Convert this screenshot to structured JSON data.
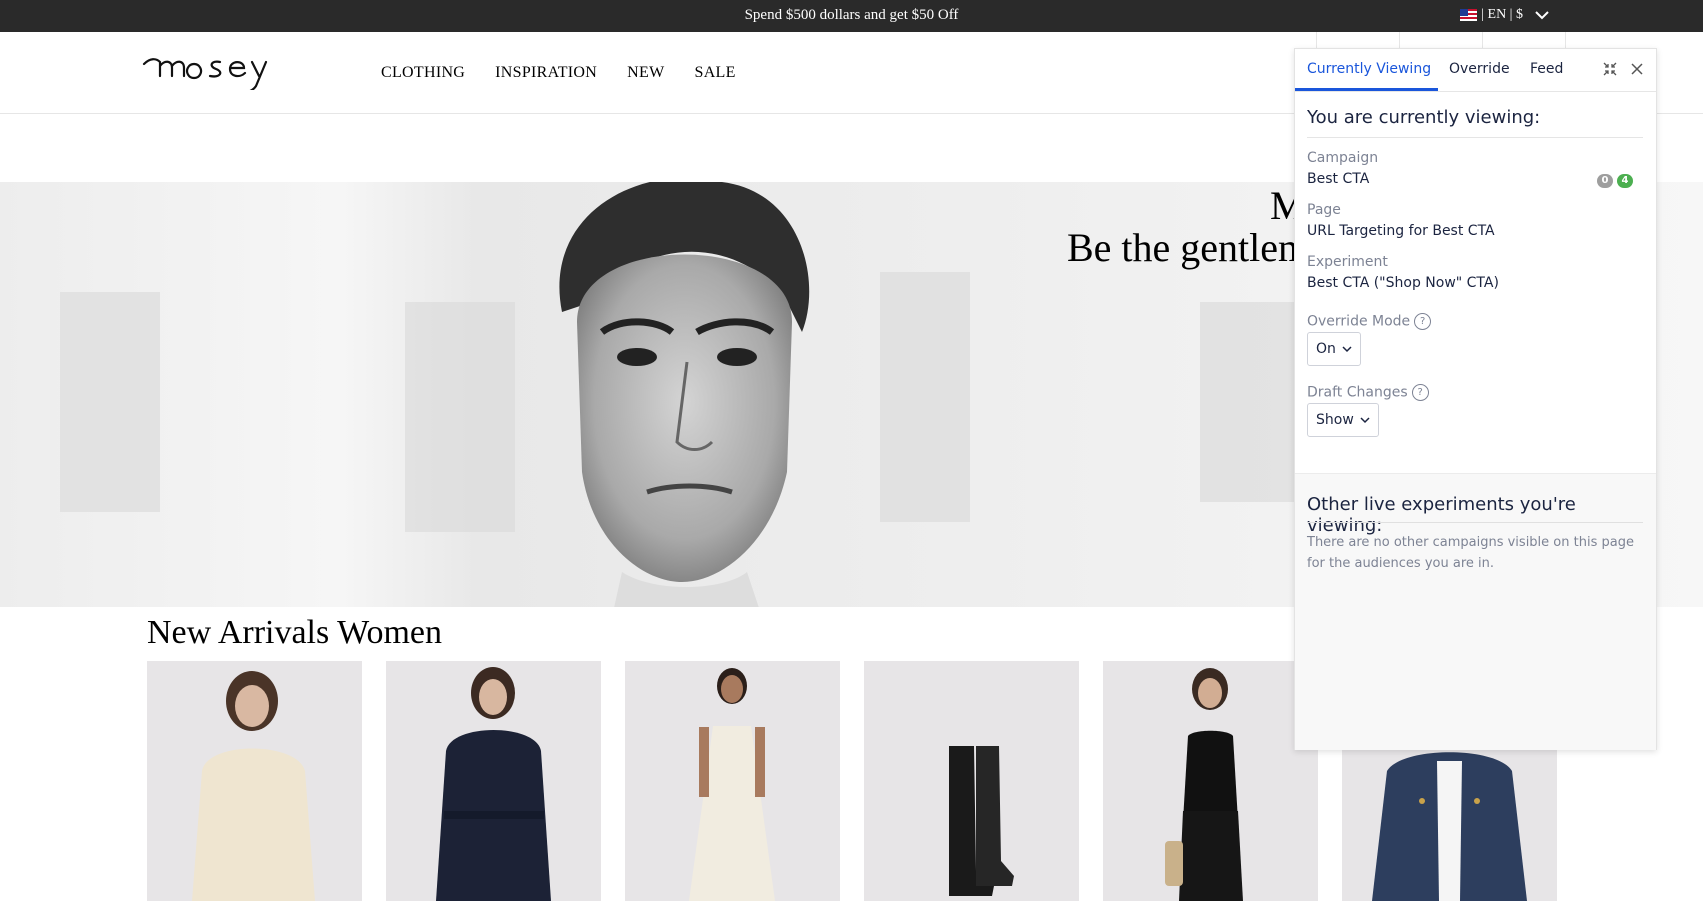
{
  "promo": {
    "text": "Spend $500 dollars and get $50 Off",
    "locale": "| EN | $"
  },
  "header": {
    "logo_text": "mosey",
    "nav": [
      "CLOTHING",
      "INSPIRATION",
      "NEW",
      "SALE"
    ]
  },
  "hero": {
    "title": "M",
    "subtitle": "Be the gentlema"
  },
  "arrivals": {
    "title": "New Arrivals Women",
    "products": [
      "cream-shirt",
      "navy-coat",
      "cream-dress",
      "black-boots",
      "black-tank-outfit",
      "denim-jacket"
    ]
  },
  "panel": {
    "tabs": [
      "Currently Viewing",
      "Override",
      "Feed"
    ],
    "heading": "You are currently viewing:",
    "campaign_label": "Campaign",
    "campaign_value": "Best CTA",
    "badge_grey": "0",
    "badge_green": "4",
    "page_label": "Page",
    "page_value": "URL Targeting for Best CTA",
    "experiment_label": "Experiment",
    "experiment_value": "Best CTA (\"Shop Now\" CTA)",
    "override_label": "Override Mode",
    "override_value": "On",
    "draft_label": "Draft Changes",
    "draft_value": "Show",
    "help_glyph": "?",
    "other_heading": "Other live experiments you're viewing:",
    "other_note": "There are no other campaigns visible on this page for the audiences you are in."
  },
  "colors": {
    "accent": "#1a56db",
    "badge_green": "#4caf50",
    "badge_grey": "#9e9e9e",
    "promo_bg": "#2a2a2a"
  },
  "icons": [
    "us-flag-icon",
    "chevron-down-icon",
    "collapse-icon",
    "close-icon",
    "help-icon"
  ]
}
